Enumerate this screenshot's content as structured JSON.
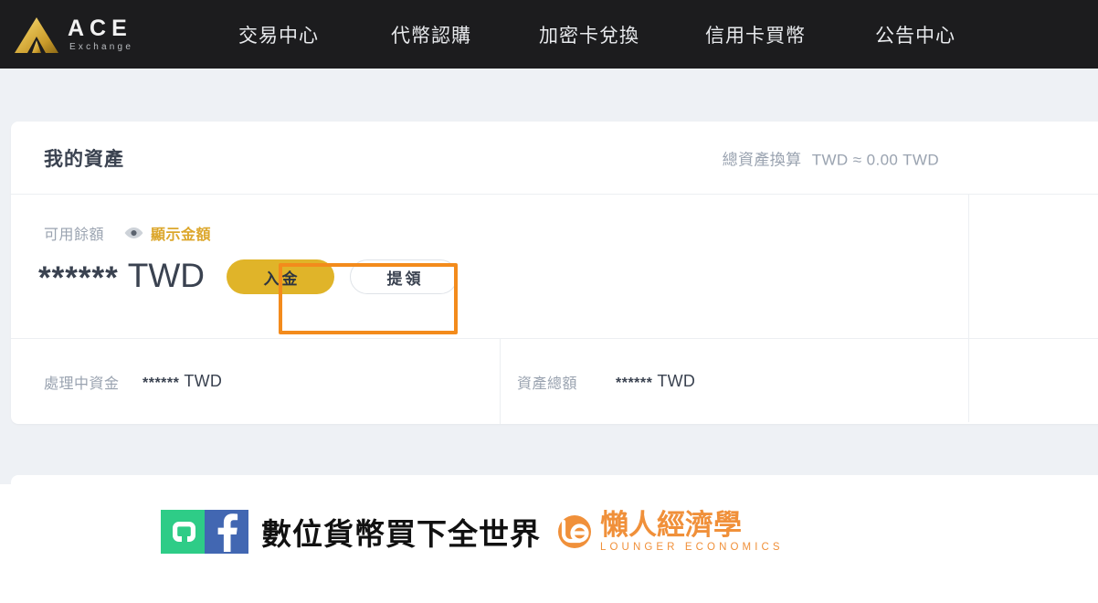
{
  "header": {
    "brand": {
      "name": "ACE",
      "subtitle": "Exchange",
      "logo_icon": "ace-triangle-logo",
      "logo_color": "#d8ac3f"
    },
    "nav": [
      {
        "label": "交易中心"
      },
      {
        "label": "代幣認購"
      },
      {
        "label": "加密卡兌換"
      },
      {
        "label": "信用卡買幣"
      },
      {
        "label": "公告中心"
      }
    ],
    "background_color": "#1c1c1e"
  },
  "asset_card": {
    "title": "我的資產",
    "total_convert": {
      "label": "總資產換算",
      "value": "TWD ≈ 0.00 TWD"
    },
    "available": {
      "label": "可用餘額",
      "toggle_label": "顯示金額",
      "toggle_icon": "eye-icon",
      "toggle_color": "#dca72c",
      "amount_masked": "******",
      "currency": "TWD"
    },
    "actions": {
      "deposit_label": "入金",
      "deposit_color": "#e0b429",
      "withdraw_label": "提領",
      "highlight_color": "#f38b1c",
      "highlight_target": "入金"
    },
    "details": [
      {
        "label": "處理中資金",
        "amount_masked": "******",
        "currency": "TWD"
      },
      {
        "label": "資產總額",
        "amount_masked": "******",
        "currency": "TWD"
      }
    ]
  },
  "footer": {
    "social": [
      {
        "name": "line",
        "color": "#2ecc87"
      },
      {
        "name": "facebook",
        "color": "#4267b2"
      }
    ],
    "tagline": "數位貨幣買下全世界",
    "brand": {
      "chinese": "懶人經濟學",
      "english": "LOUNGER ECONOMICS",
      "color": "#f0903a"
    }
  }
}
